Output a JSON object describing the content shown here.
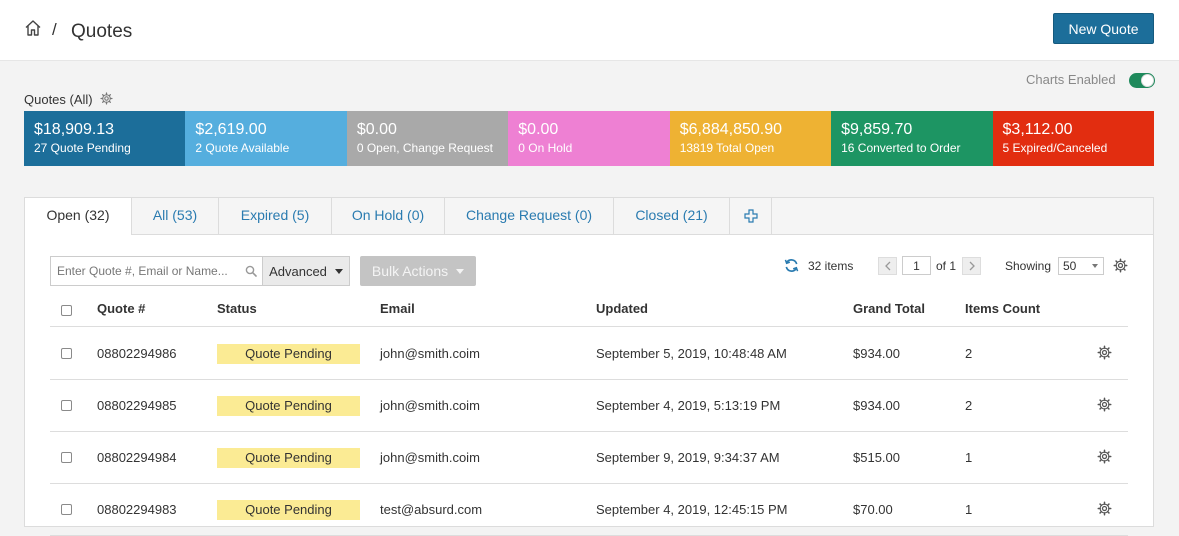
{
  "header": {
    "breadcrumb_sep": "/",
    "title": "Quotes",
    "new_button": "New Quote"
  },
  "charts_toggle": {
    "label": "Charts Enabled",
    "enabled": true
  },
  "section_title": "Quotes (All)",
  "tiles": [
    {
      "amount": "$18,909.13",
      "label": "27 Quote Pending",
      "color": "#1c6e9a"
    },
    {
      "amount": "$2,619.00",
      "label": "2 Quote Available",
      "color": "#55aede"
    },
    {
      "amount": "$0.00",
      "label": "0 Open, Change Request",
      "color": "#a9a9a9"
    },
    {
      "amount": "$0.00",
      "label": "0 On Hold",
      "color": "#ee80d3"
    },
    {
      "amount": "$6,884,850.90",
      "label": "13819 Total Open",
      "color": "#eeb233"
    },
    {
      "amount": "$9,859.70",
      "label": "16 Converted to Order",
      "color": "#1d9563"
    },
    {
      "amount": "$3,112.00",
      "label": "5 Expired/Canceled",
      "color": "#e22d10"
    }
  ],
  "tabs": [
    {
      "label": "Open (32)",
      "active": true
    },
    {
      "label": "All (53)",
      "active": false
    },
    {
      "label": "Expired (5)",
      "active": false
    },
    {
      "label": "On Hold (0)",
      "active": false
    },
    {
      "label": "Change Request (0)",
      "active": false
    },
    {
      "label": "Closed (21)",
      "active": false
    }
  ],
  "toolbar": {
    "search_placeholder": "Enter Quote #, Email or Name...",
    "advanced_label": "Advanced",
    "bulk_label": "Bulk Actions",
    "items_count": "32 items",
    "page_value": "1",
    "page_of": "of 1",
    "showing_label": "Showing",
    "showing_value": "50"
  },
  "table": {
    "columns": [
      "Quote #",
      "Status",
      "Email",
      "Updated",
      "Grand Total",
      "Items Count"
    ],
    "rows": [
      {
        "quote": "08802294986",
        "status": "Quote Pending",
        "email": "john@smith.coim",
        "updated": "September 5, 2019, 10:48:48 AM",
        "total": "$934.00",
        "count": "2"
      },
      {
        "quote": "08802294985",
        "status": "Quote Pending",
        "email": "john@smith.coim",
        "updated": "September 4, 2019, 5:13:19 PM",
        "total": "$934.00",
        "count": "2"
      },
      {
        "quote": "08802294984",
        "status": "Quote Pending",
        "email": "john@smith.coim",
        "updated": "September 9, 2019, 9:34:37 AM",
        "total": "$515.00",
        "count": "1"
      },
      {
        "quote": "08802294983",
        "status": "Quote Pending",
        "email": "test@absurd.com",
        "updated": "September 4, 2019, 12:45:15 PM",
        "total": "$70.00",
        "count": "1"
      }
    ]
  }
}
